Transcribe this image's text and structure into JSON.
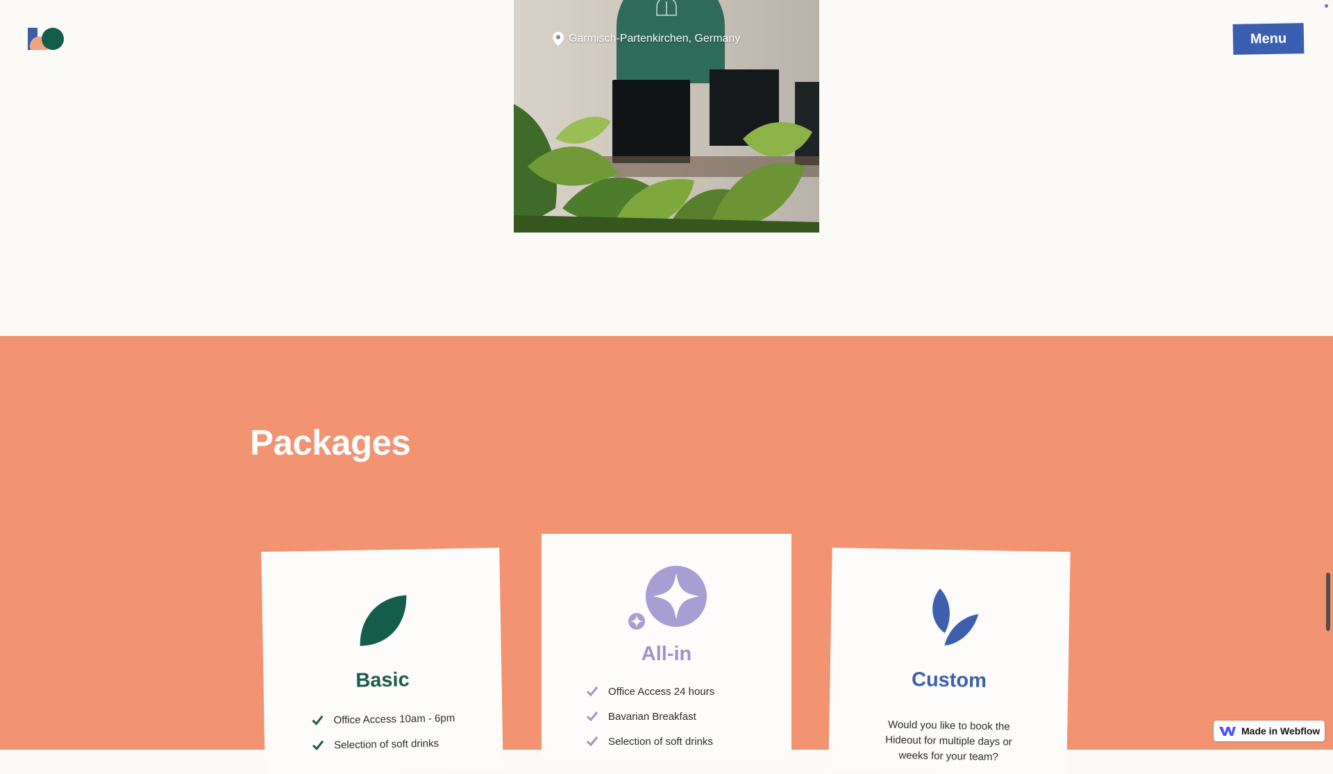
{
  "header": {
    "logo_icon": "brand-logo-shapes",
    "menu_label": "Menu"
  },
  "hero": {
    "location_icon": "map-pin-icon",
    "location": "Garmisch-Partenkirchen, Germany"
  },
  "packages": {
    "title": "Packages",
    "cards": [
      {
        "name": "Basic",
        "icon": "leaf-icon",
        "color": "#1a5c4c",
        "features": [
          "Office Access 10am - 6pm",
          "Selection of soft drinks"
        ]
      },
      {
        "name": "All-in",
        "icon": "sparkle-icon",
        "color": "#9d95c9",
        "features": [
          "Office Access 24 hours",
          "Bavarian Breakfast",
          "Selection of soft drinks"
        ]
      },
      {
        "name": "Custom",
        "icon": "twin-leaves-icon",
        "color": "#3c5fae",
        "description": "Would you like to book the Hideout for multiple days or weeks for your team?"
      }
    ]
  },
  "badge": {
    "label": "Made in Webflow",
    "icon": "webflow-logo-icon"
  },
  "colors": {
    "background": "#fcfaf7",
    "packages_background": "#f29372",
    "menu_button": "#3a5fb0"
  }
}
